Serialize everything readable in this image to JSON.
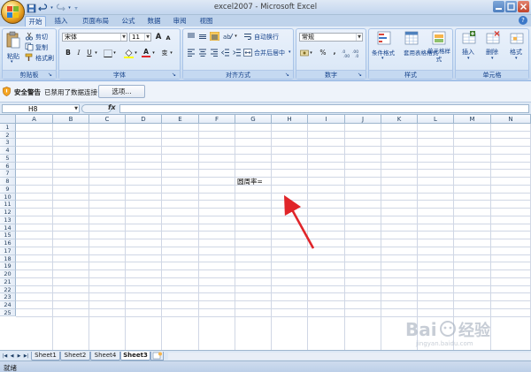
{
  "app": {
    "window_title": "excel2007 - Microsoft Excel"
  },
  "tabs": [
    "开始",
    "插入",
    "页面布局",
    "公式",
    "数据",
    "审阅",
    "视图"
  ],
  "ribbon": {
    "clipboard": {
      "paste_label": "粘贴",
      "cut_label": "剪切",
      "copy_label": "复制",
      "format_painter_label": "格式刷",
      "group_label": "剪贴板"
    },
    "font": {
      "font_name": "宋体",
      "font_size": "11",
      "bold": "B",
      "italic": "I",
      "underline": "U",
      "grow": "A",
      "shrink": "A",
      "font_color_glyph": "A",
      "phonetic_glyph": "变",
      "group_label": "字体"
    },
    "alignment": {
      "wrap_label": "自动换行",
      "merge_label": "合并后居中",
      "group_label": "对齐方式"
    },
    "number": {
      "format_value": "常规",
      "percent": "%",
      "comma": ",",
      "group_label": "数字"
    },
    "styles": {
      "conditional_label": "条件格式",
      "table_label": "套用表格格式",
      "cell_style_label": "单元格样式",
      "group_label": "样式"
    },
    "cells": {
      "insert_label": "插入",
      "delete_label": "删除",
      "format_label": "格式",
      "group_label": "单元格"
    }
  },
  "security_bar": {
    "title": "安全警告",
    "message": "已禁用了数据连接",
    "options_button": "选项..."
  },
  "formula_bar": {
    "name_box": "H8",
    "fx_label": "fx",
    "formula": ""
  },
  "grid": {
    "columns": [
      "A",
      "B",
      "C",
      "D",
      "E",
      "F",
      "G",
      "H",
      "I",
      "J",
      "K",
      "L",
      "M",
      "N"
    ],
    "rows": [
      "1",
      "2",
      "3",
      "4",
      "5",
      "6",
      "7",
      "8",
      "9",
      "10",
      "11",
      "12",
      "13",
      "14",
      "15",
      "16",
      "17",
      "18",
      "19",
      "20",
      "21",
      "22",
      "23",
      "24",
      "25"
    ],
    "cells": [
      {
        "ref": "G8",
        "text": "圆周率="
      }
    ]
  },
  "sheets": {
    "tabs": [
      "Sheet1",
      "Sheet2",
      "Sheet4",
      "Sheet3"
    ],
    "active": "Sheet3"
  },
  "status": {
    "text": "就绪"
  },
  "watermark": {
    "text": "Bai 经验",
    "subtext": "jingyan.baidu.com"
  },
  "colors": {
    "annotation_arrow": "#e0252a",
    "ribbon_text": "#15428b"
  }
}
